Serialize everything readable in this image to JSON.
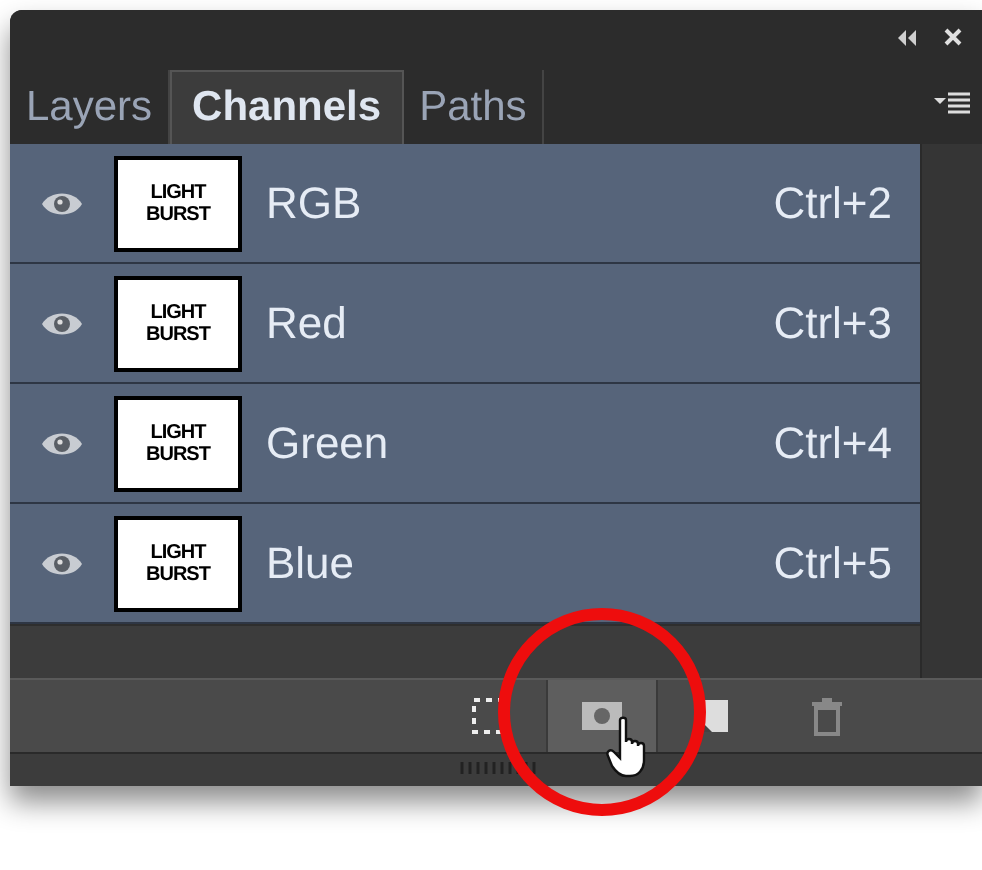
{
  "panel": {
    "tabs": [
      {
        "label": "Layers",
        "selected": false
      },
      {
        "label": "Channels",
        "selected": true
      },
      {
        "label": "Paths",
        "selected": false
      }
    ]
  },
  "channels": [
    {
      "name": "RGB",
      "shortcut": "Ctrl+2",
      "visible": true,
      "selected": true,
      "thumbnail": [
        "LIGHT",
        "BURST"
      ]
    },
    {
      "name": "Red",
      "shortcut": "Ctrl+3",
      "visible": true,
      "selected": true,
      "thumbnail": [
        "LIGHT",
        "BURST"
      ]
    },
    {
      "name": "Green",
      "shortcut": "Ctrl+4",
      "visible": true,
      "selected": true,
      "thumbnail": [
        "LIGHT",
        "BURST"
      ]
    },
    {
      "name": "Blue",
      "shortcut": "Ctrl+5",
      "visible": true,
      "selected": true,
      "thumbnail": [
        "LIGHT",
        "BURST"
      ]
    }
  ],
  "toolbar": [
    {
      "kind": "selection",
      "selected": false
    },
    {
      "kind": "mask",
      "selected": true
    },
    {
      "kind": "new",
      "selected": false
    },
    {
      "kind": "delete",
      "selected": false
    }
  ]
}
